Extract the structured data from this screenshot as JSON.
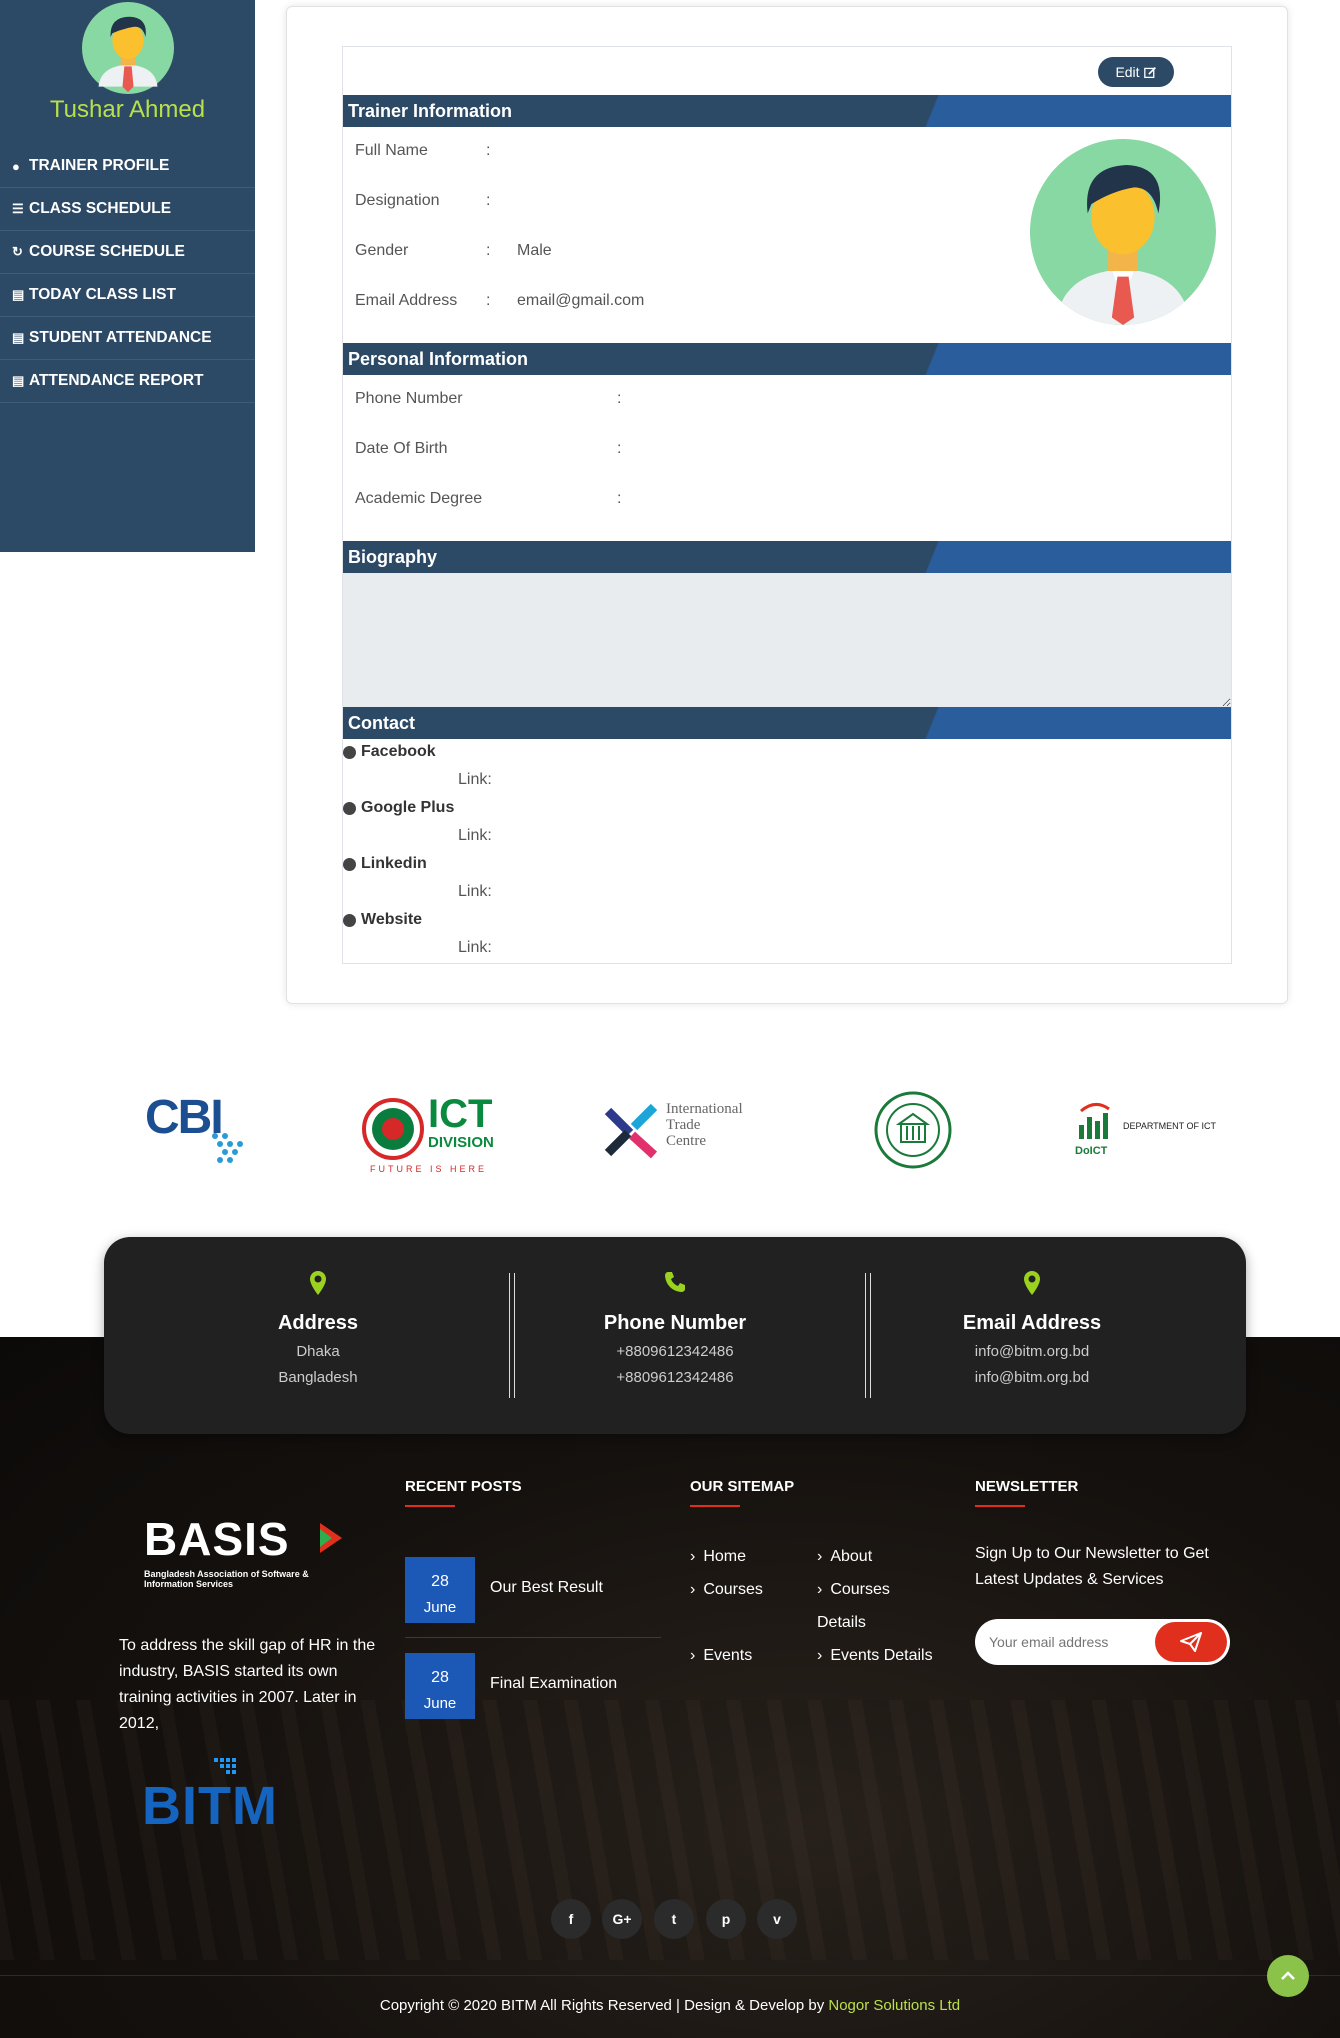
{
  "sidebar": {
    "user_name": "Tushar Ahmed",
    "menu": [
      {
        "label": "TRAINER PROFILE",
        "icon": "user-icon"
      },
      {
        "label": "CLASS SCHEDULE",
        "icon": "list-icon"
      },
      {
        "label": "COURSE SCHEDULE",
        "icon": "history-icon"
      },
      {
        "label": "TODAY CLASS LIST",
        "icon": "id-card-icon"
      },
      {
        "label": "STUDENT ATTENDANCE",
        "icon": "id-card-icon"
      },
      {
        "label": "ATTENDANCE REPORT",
        "icon": "id-card-icon"
      }
    ]
  },
  "profile": {
    "edit_label": "Edit",
    "trainer_section": "Trainer Information",
    "trainer_fields": [
      {
        "label": "Full Name",
        "value": ""
      },
      {
        "label": "Designation",
        "value": ""
      },
      {
        "label": "Gender",
        "value": "Male"
      },
      {
        "label": "Email Address",
        "value": "email@gmail.com"
      }
    ],
    "personal_section": "Personal Information",
    "personal_fields": [
      {
        "label": "Phone Number",
        "value": ""
      },
      {
        "label": "Date Of Birth",
        "value": ""
      },
      {
        "label": "Academic Degree",
        "value": ""
      }
    ],
    "colon": ":",
    "biography_section": "Biography",
    "biography_value": "",
    "contact_section": "Contact",
    "contacts": [
      {
        "name": "Facebook",
        "link_label": "Link:"
      },
      {
        "name": "Google Plus",
        "link_label": "Link:"
      },
      {
        "name": "Linkedin",
        "link_label": "Link:"
      },
      {
        "name": "Website",
        "link_label": "Link:"
      }
    ]
  },
  "partners": {
    "cbi": "CBI",
    "ict": "ICT",
    "ict_sub": "DIVISION",
    "ict_tag": "FUTURE IS HERE",
    "itc": [
      "International",
      "Trade",
      "Centre"
    ],
    "doict": "DoICT",
    "doict_text": "DEPARTMENT OF ICT"
  },
  "contact_info": {
    "address": {
      "title": "Address",
      "lines": [
        "Dhaka",
        "Bangladesh"
      ]
    },
    "phone": {
      "title": "Phone Number",
      "lines": [
        "+8809612342486",
        "+8809612342486"
      ]
    },
    "email": {
      "title": "Email Address",
      "lines": [
        "info@bitm.org.bd",
        "info@bitm.org.bd"
      ]
    }
  },
  "footer": {
    "basis_name": "BASIS",
    "basis_sub": "Bangladesh Association of Software & Information Services",
    "about_text": "To address the skill gap of HR in the industry, BASIS started its own training activities in 2007. Later in 2012,",
    "bitm_name": "BITM",
    "recent_posts_title": "RECENT POSTS",
    "posts": [
      {
        "day": "28",
        "month": "June",
        "title": "Our Best Result"
      },
      {
        "day": "28",
        "month": "June",
        "title": "Final Examination"
      }
    ],
    "sitemap_title": "OUR SITEMAP",
    "sitemap": [
      "Home",
      "About",
      "Courses",
      "Courses",
      "Details",
      "Events",
      "Events Details"
    ],
    "newsletter_title": "NEWSLETTER",
    "newsletter_text": "Sign Up to Our Newsletter to Get Latest Updates & Services",
    "email_placeholder": "Your email address",
    "social": [
      "f",
      "G+",
      "t",
      "p",
      "v"
    ],
    "copyright": "Copyright © 2020 BITM All Rights Reserved | Design & Develop by ",
    "company": "Nogor Solutions Ltd"
  },
  "colors": {
    "sidebar": "#2c4966",
    "accent_green": "#b9e04a",
    "section_blue": "#2a5d9c",
    "post_blue": "#1c58b6",
    "red": "#e02f1c"
  }
}
